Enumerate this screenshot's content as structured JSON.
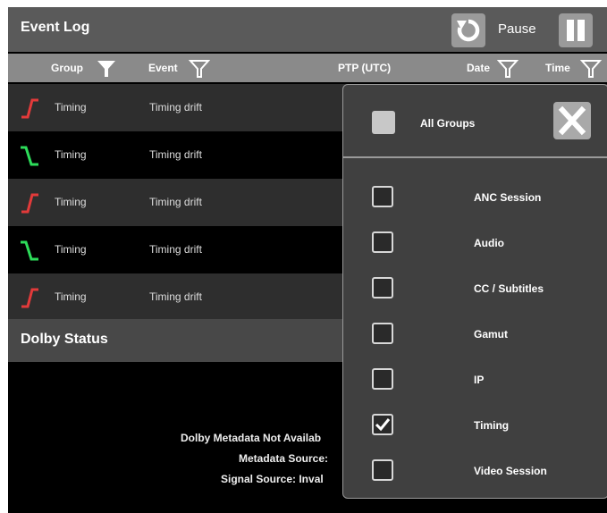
{
  "event_log": {
    "title": "Event Log",
    "pause_label": "Pause",
    "columns": {
      "group": "Group",
      "event": "Event",
      "ptp": "PTP (UTC)",
      "date": "Date",
      "time": "Time"
    },
    "rows": [
      {
        "group": "Timing",
        "event": "Timing drift",
        "trend": "up",
        "color": "#e23a3a"
      },
      {
        "group": "Timing",
        "event": "Timing drift",
        "trend": "down",
        "color": "#2ddc5a"
      },
      {
        "group": "Timing",
        "event": "Timing drift",
        "trend": "up",
        "color": "#e23a3a"
      },
      {
        "group": "Timing",
        "event": "Timing drift",
        "trend": "down",
        "color": "#2ddc5a"
      },
      {
        "group": "Timing",
        "event": "Timing drift",
        "trend": "up",
        "color": "#e23a3a"
      }
    ]
  },
  "dolby": {
    "title": "Dolby Status",
    "lines": [
      "Dolby Metadata Not Availab",
      "Metadata Source:",
      "Signal Source: Inval"
    ]
  },
  "filter_popup": {
    "all_groups_label": "All Groups",
    "options": [
      {
        "label": "ANC Session",
        "checked": false
      },
      {
        "label": "Audio",
        "checked": false
      },
      {
        "label": "CC / Subtitles",
        "checked": false
      },
      {
        "label": "Gamut",
        "checked": false
      },
      {
        "label": "IP",
        "checked": false
      },
      {
        "label": "Timing",
        "checked": true
      },
      {
        "label": "Video Session",
        "checked": false
      }
    ]
  },
  "colors": {
    "alarm_up": "#e23a3a",
    "alarm_down": "#2ddc5a",
    "header_bg": "#5a5a5a",
    "panel_bg": "#404040"
  }
}
